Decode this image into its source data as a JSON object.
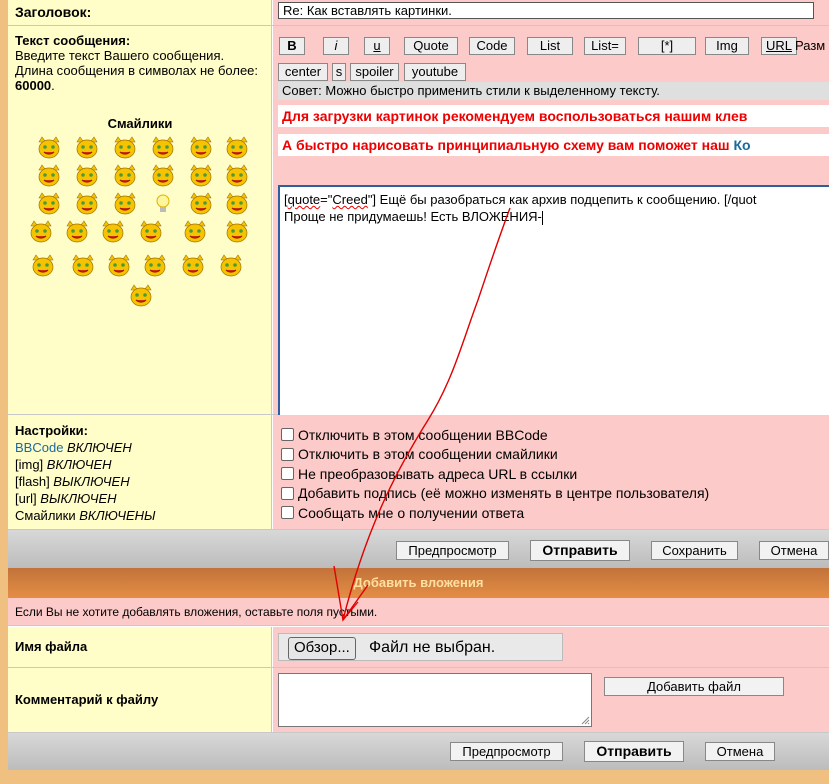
{
  "subject": {
    "label": "Заголовок:",
    "value": "Re: Как вставлять картинки."
  },
  "message": {
    "label": "Текст сообщения:",
    "hint": "Введите текст Вашего сообщения. Длина сообщения в символах не более: ",
    "max_len": "60000",
    "smilies_title": "Смайлики",
    "text_line1_pre": "[",
    "text_line1_quote": "quote",
    "text_line1_eq": "=\"",
    "text_line1_name": "Creed",
    "text_line1_rest": "\"] Ещё бы разобраться как архив подцепить к сообщению. [/quot",
    "text_line2": "Проще не придумаешь! Есть ВЛОЖЕНИЯ-"
  },
  "toolbar": {
    "row1": [
      "B",
      "i",
      "u",
      "Quote",
      "Code",
      "List",
      "List=",
      "[*]",
      "Img",
      "URL"
    ],
    "size_label": "Разм",
    "row2": [
      "center",
      "s",
      "spoiler",
      "youtube"
    ],
    "tip": "Совет: Можно быстро применить стили к выделенному тексту."
  },
  "warnings": {
    "upload": "Для загрузки картинок рекомендуем воспользоваться нашим клев",
    "draw": "А быстро нарисовать принципиальную схему вам поможет наш ",
    "draw_link": "Ко"
  },
  "settings": {
    "label": "Настройки:",
    "bbcode_link": "BBCode",
    "bbcode_state": " ВКЛЮЧЕН",
    "img": "[img]",
    "img_state": " ВКЛЮЧЕН",
    "flash": "[flash]",
    "flash_state": " ВЫКЛЮЧЕН",
    "url": "[url]",
    "url_state": " ВЫКЛЮЧЕН",
    "smilies": "Смайлики",
    "smilies_state": " ВКЛЮЧЕНЫ",
    "options": [
      "Отключить в этом сообщении BBCode",
      "Отключить в этом сообщении смайлики",
      "Не преобразовывать адреса URL в ссылки",
      "Добавить подпись (её можно изменять в центре пользователя)",
      "Сообщать мне о получении ответа"
    ]
  },
  "actions": {
    "preview": "Предпросмотр",
    "submit": "Отправить",
    "save": "Сохранить",
    "cancel": "Отмена"
  },
  "attachments": {
    "header": "Добавить вложения",
    "note": "Если Вы не хотите добавлять вложения, оставьте поля пустыми.",
    "file_label": "Имя файла",
    "browse": "Обзор...",
    "no_file": "Файл не выбран.",
    "comment_label": "Комментарий к файлу",
    "add_file": "Добавить файл"
  },
  "colors": {
    "annotation": "#e00000",
    "smiley": "#f5c300"
  }
}
